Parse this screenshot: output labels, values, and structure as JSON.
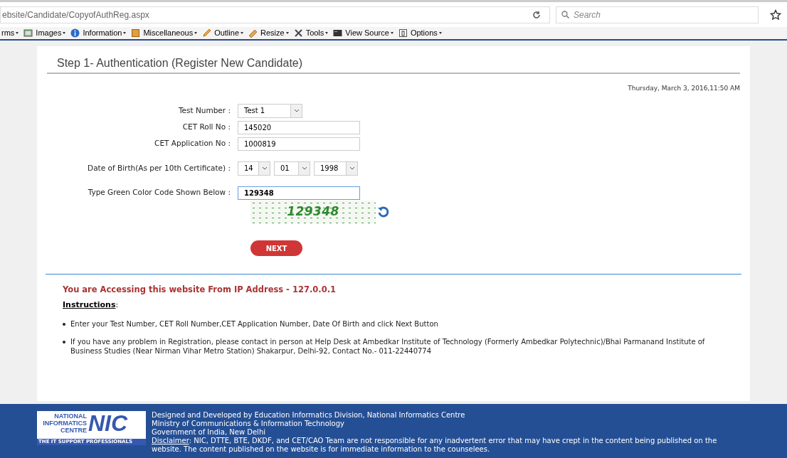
{
  "browser": {
    "url": "ebsite/Candidate/CopyofAuthReg.aspx",
    "search_placeholder": "Search",
    "toolbar": [
      {
        "label": "rms",
        "kind": "none"
      },
      {
        "label": "Images",
        "kind": "image"
      },
      {
        "label": "Information",
        "kind": "info"
      },
      {
        "label": "Miscellaneous",
        "kind": "box"
      },
      {
        "label": "Outline",
        "kind": "pencil"
      },
      {
        "label": "Resize",
        "kind": "ruler"
      },
      {
        "label": "Tools",
        "kind": "tools"
      },
      {
        "label": "View Source",
        "kind": "screen"
      },
      {
        "label": "Options",
        "kind": "options"
      }
    ]
  },
  "page": {
    "title": "Step 1- Authentication (Register New Candidate)",
    "datetime": "Thursday, March 3, 2016,11:50 AM",
    "fields": [
      {
        "kind": "select",
        "label": "Test Number :",
        "values": [
          "Test 1"
        ]
      },
      {
        "kind": "text",
        "label": "CET Roll No :",
        "value": "145020"
      },
      {
        "kind": "text",
        "label": "CET Application No :",
        "value": "1000819"
      },
      {
        "kind": "date",
        "label": "Date of Birth(As per 10th Certificate) :",
        "values": [
          "14",
          "01",
          "1998"
        ]
      },
      {
        "kind": "captcha",
        "label": "Type Green Color Code Shown Below :",
        "value": "129348",
        "focused": true
      }
    ],
    "captcha_text": "129348",
    "next_button": "NEXT",
    "ip_notice": "You are Accessing this website From IP Address - 127.0.0.1",
    "instructions_heading": "Instructions",
    "instructions_colon": ":",
    "instructions": [
      "Enter your Test Number, CET Roll Number,CET Application Number, Date Of Birth and click Next Button",
      "If you have any problem in  Registration, please contact in person at Help Desk at Ambedkar Institute of Technology (Formerly Ambedkar Polytechnic)/Bhai Parmanand Institute of Business Studies (Near Nirman Vihar Metro Station) Shakarpur, Delhi-92, Contact No.- 011-22440774"
    ]
  },
  "footer": {
    "logo_lines": [
      "NATIONAL",
      "INFORMATICS",
      "CENTRE"
    ],
    "logo_mark": "NIC",
    "logo_tagline": "THE IT SUPPORT PROFESSIONALS",
    "lines": [
      "Designed and Developed by Education Informatics Division, National Informatics Centre",
      "Ministry of Communications & Information Technology",
      "Government of India, New Delhi"
    ],
    "disclaimer_label": "Disclaimer",
    "disclaimer": ": NIC, DTTE, BTE, DKDF, and CET/CAO Team are not responsible for any inadvertent error that may have crept in the content being published on the website. The content published on the website is for immediate information to the counselees."
  }
}
